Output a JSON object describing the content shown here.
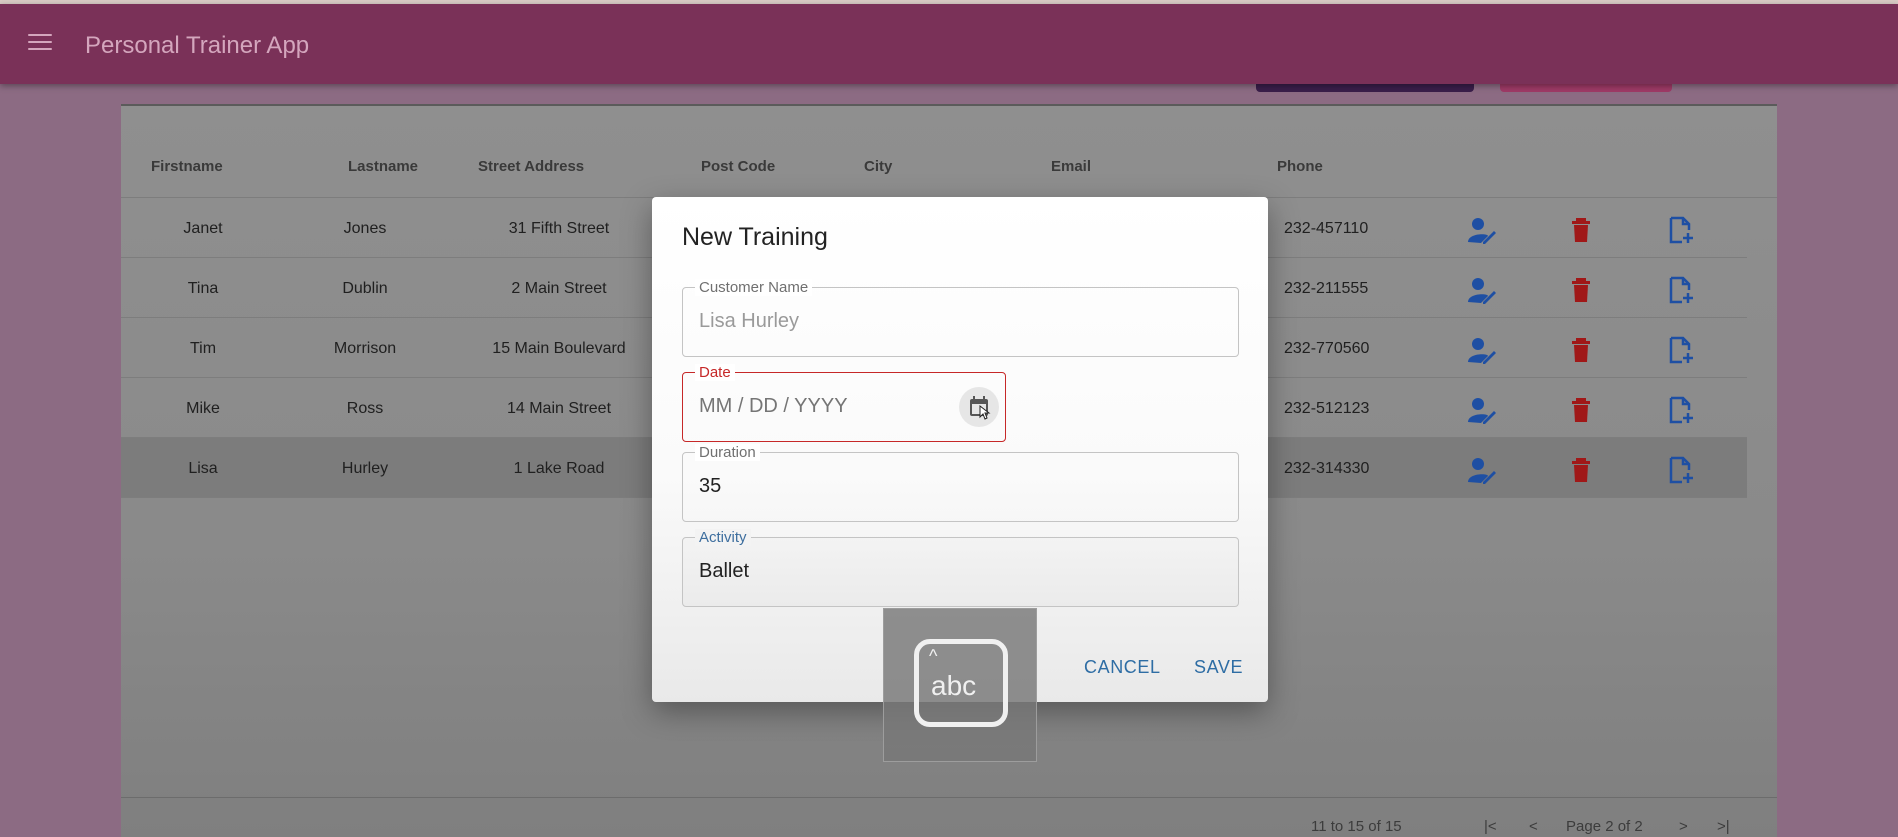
{
  "appbar": {
    "title": "Personal Trainer App"
  },
  "table": {
    "headers": [
      "Firstname",
      "Lastname",
      "Street Address",
      "Post Code",
      "City",
      "Email",
      "Phone"
    ],
    "rows": [
      {
        "firstname": "Janet",
        "lastname": "Jones",
        "street": "31 Fifth Street",
        "phone": "232-457110"
      },
      {
        "firstname": "Tina",
        "lastname": "Dublin",
        "street": "2 Main Street",
        "phone": "232-211555"
      },
      {
        "firstname": "Tim",
        "lastname": "Morrison",
        "street": "15 Main Boulevard",
        "phone": "232-770560"
      },
      {
        "firstname": "Mike",
        "lastname": "Ross",
        "street": "14 Main Street",
        "phone": "232-512123"
      },
      {
        "firstname": "Lisa",
        "lastname": "Hurley",
        "street": "1 Lake Road",
        "phone": "232-314330"
      }
    ]
  },
  "pagination": {
    "range": "11 to 15 of 15",
    "page": "Page 2 of 2"
  },
  "dialog": {
    "title": "New Training",
    "customer_label": "Customer Name",
    "customer_value": "Lisa Hurley",
    "date_label": "Date",
    "date_placeholder": "MM / DD / YYYY",
    "duration_label": "Duration",
    "duration_value": "35",
    "activity_label": "Activity",
    "activity_value": "Ballet",
    "cancel_label": "CANCEL",
    "save_label": "SAVE"
  },
  "ime": {
    "text": "abc"
  },
  "colors": {
    "appbar": "#7a3158",
    "edit_icon": "#1e4fa3",
    "delete_icon": "#a01818",
    "add_icon": "#1e4fa3",
    "error": "#c62828",
    "accent": "#2e6da4"
  },
  "icons": {
    "menu": "menu-icon",
    "edit": "user-edit-icon",
    "delete": "trash-icon",
    "add": "file-add-icon",
    "calendar": "calendar-icon"
  }
}
